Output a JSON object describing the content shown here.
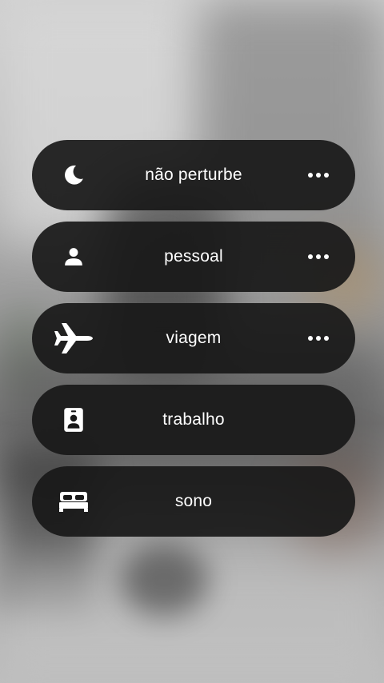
{
  "modes": [
    {
      "label": "não perturbe",
      "icon": "moon-icon",
      "has_more": true
    },
    {
      "label": "pessoal",
      "icon": "person-icon",
      "has_more": true
    },
    {
      "label": "viagem",
      "icon": "airplane-icon",
      "has_more": true
    },
    {
      "label": "trabalho",
      "icon": "id-badge-icon",
      "has_more": false
    },
    {
      "label": "sono",
      "icon": "bed-icon",
      "has_more": false
    }
  ],
  "colors": {
    "pill_background": "#181818",
    "text": "#ffffff"
  }
}
